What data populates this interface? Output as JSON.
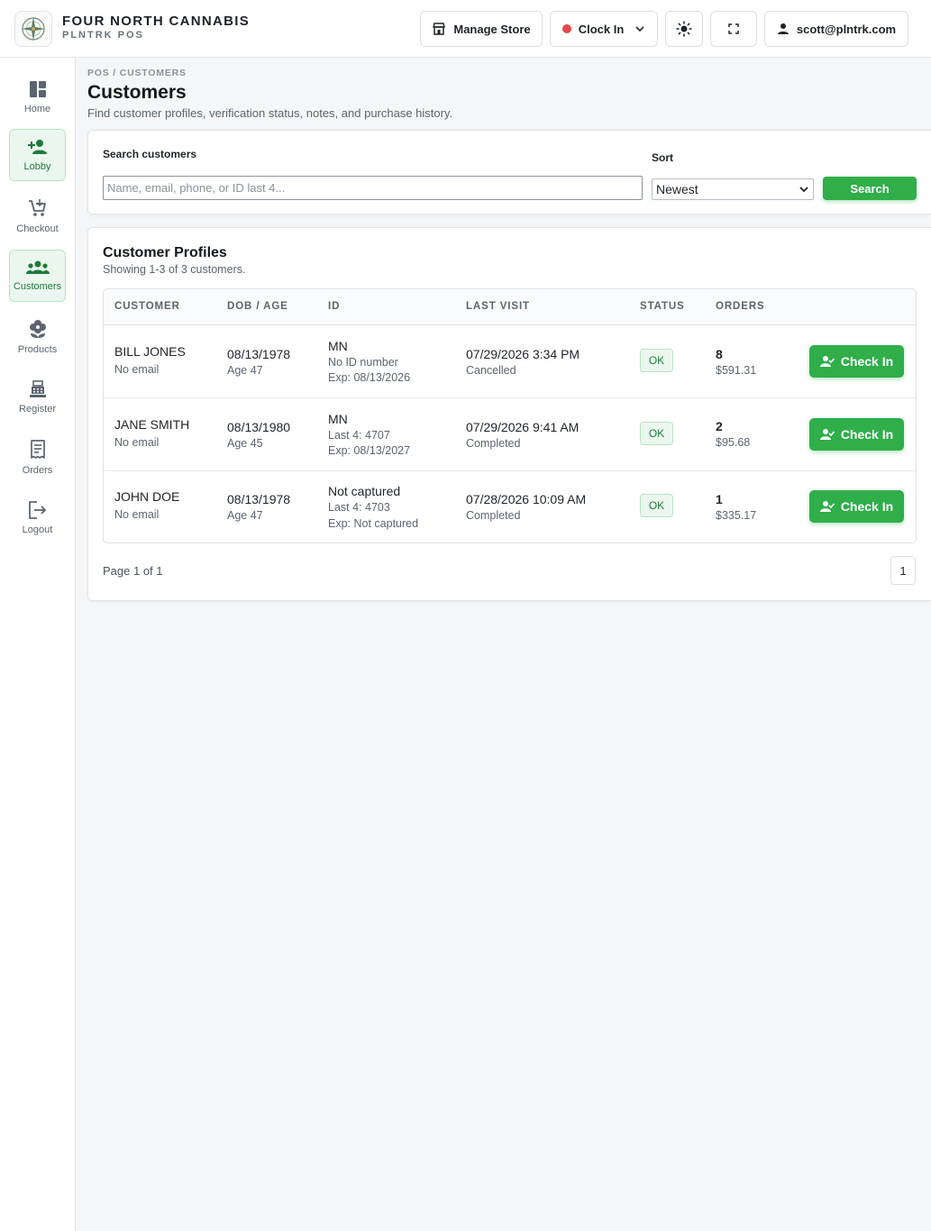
{
  "header": {
    "brand_name": "FOUR NORTH CANNABIS",
    "brand_sub": "PLNTRK POS",
    "manage_store_label": "Manage Store",
    "clock_in_label": "Clock In",
    "user_email": "scott@plntrk.com",
    "clock_status_color": "#e5484d"
  },
  "sidebar": {
    "items": [
      {
        "label": "Home",
        "icon": "dashboard-icon",
        "active": false
      },
      {
        "label": "Lobby",
        "icon": "person-add-icon",
        "active": true
      },
      {
        "label": "Checkout",
        "icon": "cart-icon",
        "active": false
      },
      {
        "label": "Customers",
        "icon": "group-icon",
        "active": true
      },
      {
        "label": "Products",
        "icon": "flower-icon",
        "active": false
      },
      {
        "label": "Register",
        "icon": "register-icon",
        "active": false
      },
      {
        "label": "Orders",
        "icon": "receipt-icon",
        "active": false
      },
      {
        "label": "Logout",
        "icon": "logout-icon",
        "active": false
      }
    ]
  },
  "breadcrumb": "POS / CUSTOMERS",
  "page": {
    "title": "Customers",
    "subtitle": "Find customer profiles, verification status, notes, and purchase history."
  },
  "search": {
    "label": "Search customers",
    "placeholder": "Name, email, phone, or ID last 4...",
    "value": "",
    "sort_label": "Sort",
    "sort_value": "Newest",
    "button_label": "Search"
  },
  "profiles": {
    "title": "Customer Profiles",
    "summary": "Showing 1-3 of 3 customers.",
    "columns": [
      "CUSTOMER",
      "DOB / AGE",
      "ID",
      "LAST VISIT",
      "STATUS",
      "ORDERS"
    ],
    "rows": [
      {
        "name": "BILL JONES",
        "email": "No email",
        "dob": "08/13/1978",
        "age": "Age 47",
        "id_state": "MN",
        "id_number": "No ID number",
        "id_exp": "Exp: 08/13/2026",
        "last_visit": "07/29/2026 3:34 PM",
        "visit_status": "Cancelled",
        "status": "OK",
        "orders": "8",
        "total": "$591.31",
        "action": "Check In"
      },
      {
        "name": "JANE SMITH",
        "email": "No email",
        "dob": "08/13/1980",
        "age": "Age 45",
        "id_state": "MN",
        "id_number": "Last 4: 4707",
        "id_exp": "Exp: 08/13/2027",
        "last_visit": "07/29/2026 9:41 AM",
        "visit_status": "Completed",
        "status": "OK",
        "orders": "2",
        "total": "$95.68",
        "action": "Check In"
      },
      {
        "name": "JOHN DOE",
        "email": "No email",
        "dob": "08/13/1978",
        "age": "Age 47",
        "id_state": "Not captured",
        "id_number": "Last 4: 4703",
        "id_exp": "Exp: Not captured",
        "last_visit": "07/28/2026 10:09 AM",
        "visit_status": "Completed",
        "status": "OK",
        "orders": "1",
        "total": "$335.17",
        "action": "Check In"
      }
    ],
    "pager_text": "Page 1 of 1",
    "current_page": "1"
  },
  "colors": {
    "accent": "#2fae4a",
    "active_nav_bg": "#ebf7ee",
    "active_nav_text": "#1e7a3a"
  }
}
